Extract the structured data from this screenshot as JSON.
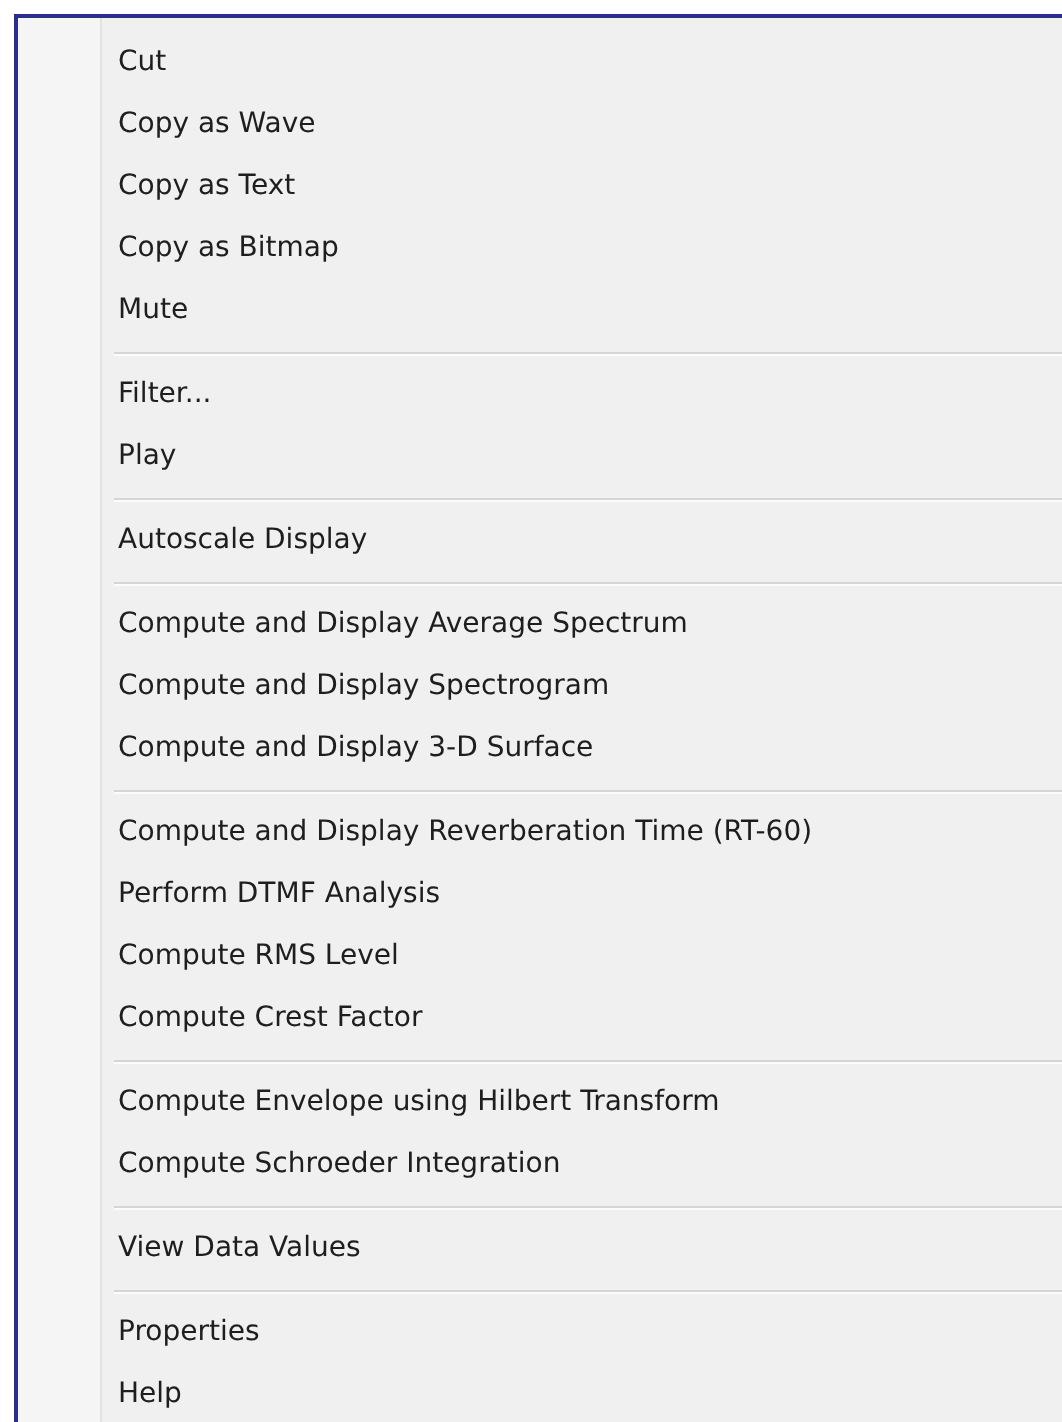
{
  "menu": {
    "items": [
      {
        "kind": "item",
        "label": "Cut"
      },
      {
        "kind": "item",
        "label": "Copy as Wave"
      },
      {
        "kind": "item",
        "label": "Copy as Text"
      },
      {
        "kind": "item",
        "label": "Copy as Bitmap"
      },
      {
        "kind": "item",
        "label": "Mute"
      },
      {
        "kind": "separator"
      },
      {
        "kind": "item",
        "label": "Filter..."
      },
      {
        "kind": "item",
        "label": "Play"
      },
      {
        "kind": "separator"
      },
      {
        "kind": "item",
        "label": "Autoscale Display"
      },
      {
        "kind": "separator"
      },
      {
        "kind": "item",
        "label": "Compute and Display Average Spectrum"
      },
      {
        "kind": "item",
        "label": "Compute and Display Spectrogram"
      },
      {
        "kind": "item",
        "label": "Compute and Display 3-D Surface"
      },
      {
        "kind": "separator"
      },
      {
        "kind": "item",
        "label": "Compute and Display Reverberation Time (RT-60)"
      },
      {
        "kind": "item",
        "label": "Perform DTMF Analysis"
      },
      {
        "kind": "item",
        "label": "Compute RMS Level"
      },
      {
        "kind": "item",
        "label": "Compute Crest Factor"
      },
      {
        "kind": "separator"
      },
      {
        "kind": "item",
        "label": "Compute Envelope using Hilbert Transform"
      },
      {
        "kind": "item",
        "label": "Compute Schroeder Integration"
      },
      {
        "kind": "separator"
      },
      {
        "kind": "item",
        "label": "View Data Values"
      },
      {
        "kind": "separator"
      },
      {
        "kind": "item",
        "label": "Properties"
      },
      {
        "kind": "item",
        "label": "Help"
      }
    ]
  }
}
